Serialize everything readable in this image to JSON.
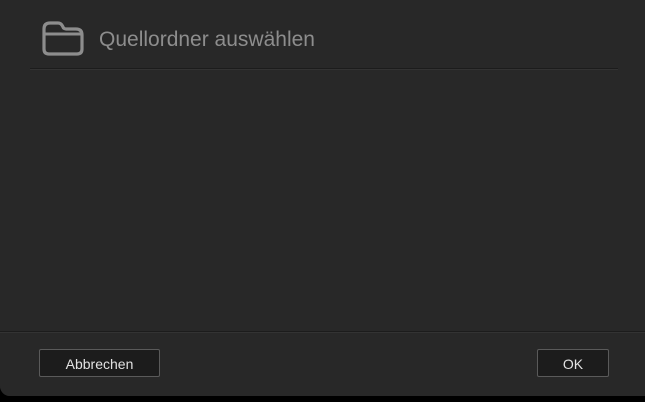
{
  "dialog": {
    "title": "Quellordner auswählen",
    "icon": "folder-icon"
  },
  "footer": {
    "cancel_label": "Abbrechen",
    "ok_label": "OK"
  },
  "colors": {
    "background": "#282828",
    "title_text": "#8d8d8d",
    "button_bg": "#1c1c1c",
    "button_border": "#5a5a5a",
    "button_text": "#e2e2e2"
  }
}
